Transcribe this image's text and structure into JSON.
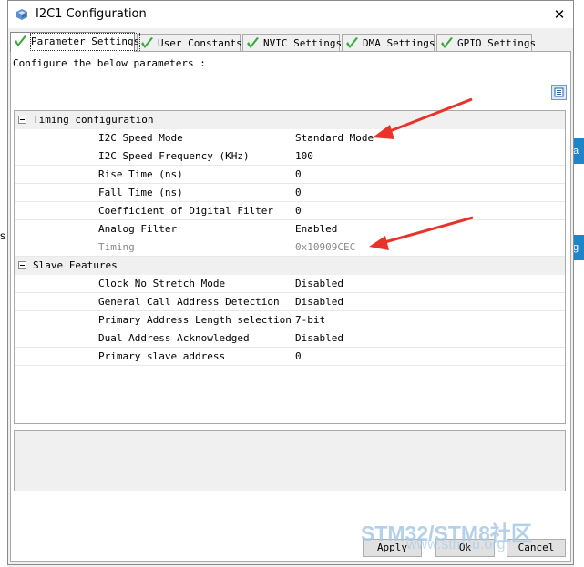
{
  "window": {
    "title": "I2C1 Configuration",
    "close_glyph": "✕"
  },
  "background": {
    "stub_text": "s",
    "btn1_text": "a",
    "btn2_text": "g"
  },
  "tabs": [
    {
      "label": "Parameter Settings",
      "active": true
    },
    {
      "label": "User Constants",
      "active": false
    },
    {
      "label": "NVIC Settings",
      "active": false
    },
    {
      "label": "DMA Settings",
      "active": false
    },
    {
      "label": "GPIO Settings",
      "active": false
    }
  ],
  "panel": {
    "description": "Configure the below parameters :"
  },
  "sections": [
    {
      "title": "Timing configuration",
      "rows": [
        {
          "name": "I2C Speed Mode",
          "value": "Standard Mode"
        },
        {
          "name": "I2C Speed Frequency (KHz)",
          "value": "100"
        },
        {
          "name": "Rise Time (ns)",
          "value": "0"
        },
        {
          "name": "Fall Time (ns)",
          "value": "0"
        },
        {
          "name": "Coefficient of Digital Filter",
          "value": "0"
        },
        {
          "name": "Analog Filter",
          "value": "Enabled"
        },
        {
          "name": "Timing",
          "value": "0x10909CEC",
          "readonly": true
        }
      ]
    },
    {
      "title": "Slave Features",
      "rows": [
        {
          "name": "Clock No Stretch Mode",
          "value": "Disabled"
        },
        {
          "name": "General Call Address Detection",
          "value": "Disabled"
        },
        {
          "name": "Primary Address Length selection",
          "value": "7-bit"
        },
        {
          "name": "Dual Address Acknowledged",
          "value": "Disabled"
        },
        {
          "name": "Primary slave address",
          "value": "0"
        }
      ]
    }
  ],
  "buttons": {
    "apply": "Apply",
    "ok": "Ok",
    "cancel": "Cancel"
  },
  "watermark": {
    "line1": "STM32/STM8社区",
    "line2": "www.stmcu.org"
  },
  "colors": {
    "accent": "#1e86c8",
    "arrow": "#e8322a",
    "check": "#3aa83a",
    "watermark": "#a9c9e6"
  }
}
